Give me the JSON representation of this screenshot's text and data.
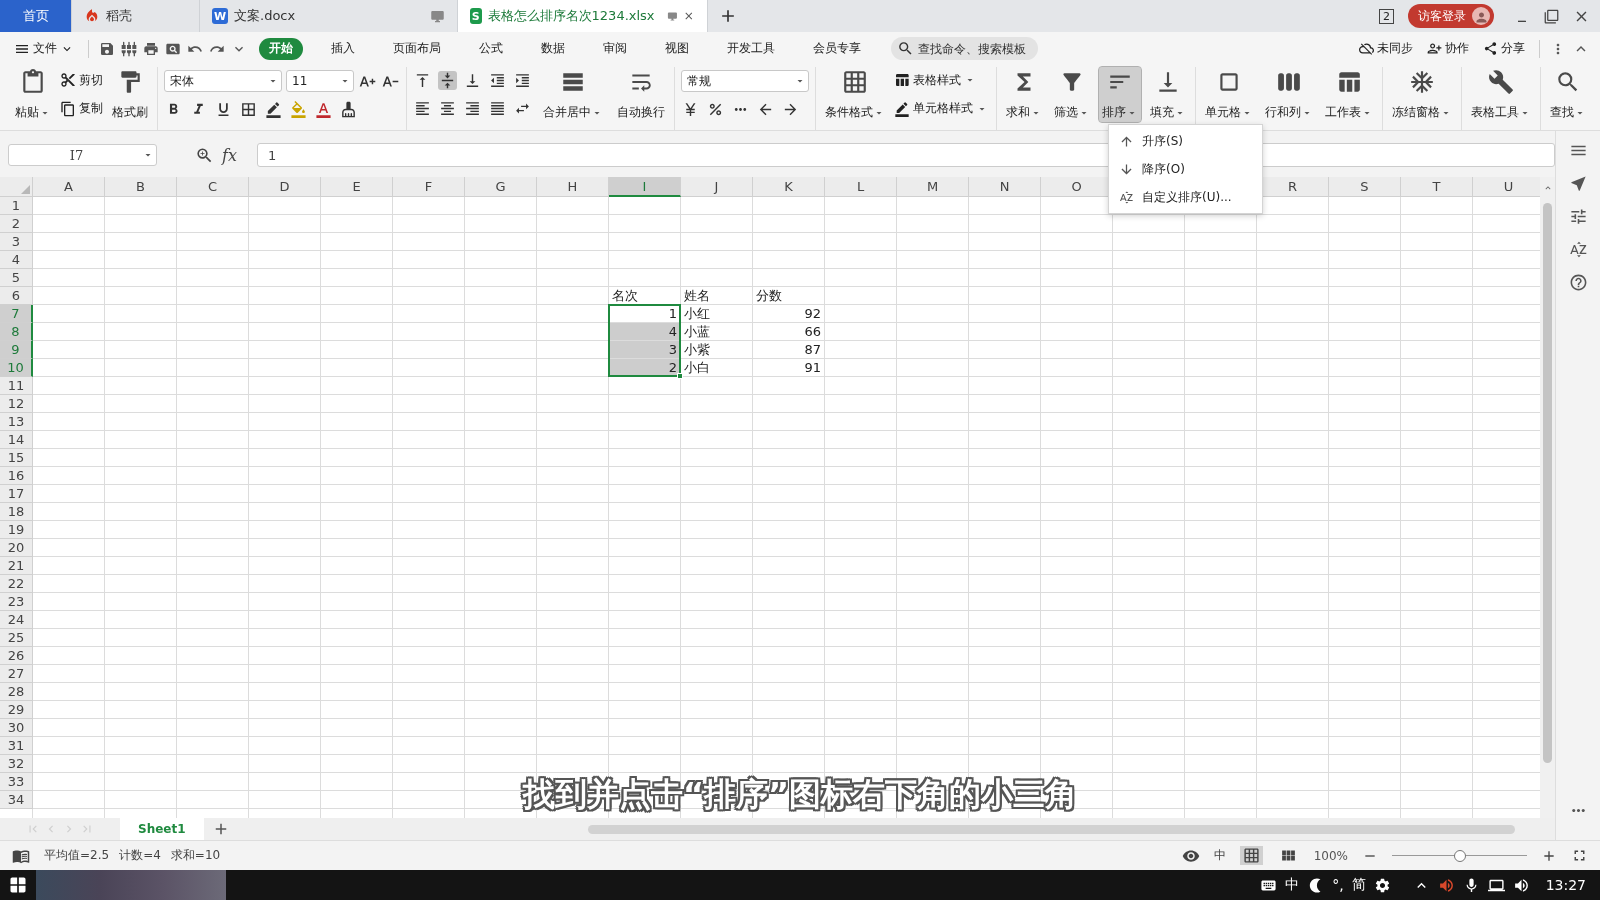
{
  "title_tabs": [
    {
      "label": "首页",
      "kind": "home",
      "selected": false
    },
    {
      "label": "稻壳",
      "kind": "docer",
      "selected": false
    },
    {
      "label": "文案.docx",
      "kind": "doc",
      "badge": "W",
      "selected": false
    },
    {
      "label": "表格怎么排序名次1234.xlsx",
      "kind": "sheet",
      "badge": "S",
      "selected": true
    }
  ],
  "window_count": "2",
  "login_button": "访客登录",
  "menu": {
    "file": "文件",
    "tabs": [
      {
        "label": "开始",
        "selected": true
      },
      {
        "label": "插入",
        "selected": false
      },
      {
        "label": "页面布局",
        "selected": false
      },
      {
        "label": "公式",
        "selected": false
      },
      {
        "label": "数据",
        "selected": false
      },
      {
        "label": "审阅",
        "selected": false
      },
      {
        "label": "视图",
        "selected": false
      },
      {
        "label": "开发工具",
        "selected": false
      },
      {
        "label": "会员专享",
        "selected": false
      }
    ],
    "search": {
      "placeholder": "查找命令、搜索模板"
    },
    "actions": [
      "未同步",
      "协作",
      "分享"
    ]
  },
  "ribbon": {
    "clipboard": {
      "paste": "粘贴",
      "cut": "剪切",
      "copy": "复制",
      "format_painter": "格式刷"
    },
    "font": {
      "name": "宋体",
      "size": "11"
    },
    "alignment": {
      "middle_pressed": true,
      "merge": "合并居中",
      "wrap": "自动换行"
    },
    "number": {
      "format": "常规"
    },
    "styles": {
      "conditional": "条件格式",
      "table_style": "表格样式",
      "cell_style": "单元格样式"
    },
    "command_groups": [
      [
        {
          "label": "求和",
          "pressed": false
        },
        {
          "label": "筛选",
          "pressed": false
        },
        {
          "label": "排序",
          "pressed": true
        },
        {
          "label": "填充",
          "pressed": false
        }
      ],
      [
        {
          "label": "单元格",
          "pressed": false
        },
        {
          "label": "行和列",
          "pressed": false
        },
        {
          "label": "工作表",
          "pressed": false
        }
      ],
      [
        {
          "label": "冻结窗格",
          "pressed": false
        }
      ],
      [
        {
          "label": "表格工具",
          "pressed": false
        }
      ],
      [
        {
          "label": "查找",
          "pressed": false
        }
      ]
    ]
  },
  "sort_menu": [
    {
      "label": "升序(S)"
    },
    {
      "label": "降序(O)"
    },
    {
      "label": "自定义排序(U)..."
    }
  ],
  "formula_bar": {
    "name_box": "I7",
    "fx": "fx",
    "value": "1"
  },
  "sheet": {
    "columns": [
      {
        "label": "A",
        "selected": false
      },
      {
        "label": "B",
        "selected": false
      },
      {
        "label": "C",
        "selected": false
      },
      {
        "label": "D",
        "selected": false
      },
      {
        "label": "E",
        "selected": false
      },
      {
        "label": "F",
        "selected": false
      },
      {
        "label": "G",
        "selected": false
      },
      {
        "label": "H",
        "selected": false
      },
      {
        "label": "I",
        "selected": true
      },
      {
        "label": "J",
        "selected": false
      },
      {
        "label": "K",
        "selected": false
      },
      {
        "label": "L",
        "selected": false
      },
      {
        "label": "M",
        "selected": false
      },
      {
        "label": "N",
        "selected": false
      },
      {
        "label": "O",
        "selected": false
      },
      null,
      null,
      {
        "label": "R",
        "selected": false
      },
      {
        "label": "S",
        "selected": false
      },
      {
        "label": "T",
        "selected": false
      },
      {
        "label": "U",
        "selected": false
      }
    ],
    "rows": [
      {
        "label": "1",
        "selected": false
      },
      {
        "label": "2",
        "selected": false
      },
      {
        "label": "3",
        "selected": false
      },
      {
        "label": "4",
        "selected": false
      },
      {
        "label": "5",
        "selected": false
      },
      {
        "label": "6",
        "selected": false
      },
      {
        "label": "7",
        "selected": true
      },
      {
        "label": "8",
        "selected": true
      },
      {
        "label": "9",
        "selected": true
      },
      {
        "label": "10",
        "selected": true
      },
      {
        "label": "11",
        "selected": false
      },
      {
        "label": "12",
        "selected": false
      },
      {
        "label": "13",
        "selected": false
      },
      {
        "label": "14",
        "selected": false
      },
      {
        "label": "15",
        "selected": false
      },
      {
        "label": "16",
        "selected": false
      },
      {
        "label": "17",
        "selected": false
      },
      {
        "label": "18",
        "selected": false
      },
      {
        "label": "19",
        "selected": false
      },
      {
        "label": "20",
        "selected": false
      },
      {
        "label": "21",
        "selected": false
      },
      {
        "label": "22",
        "selected": false
      },
      {
        "label": "23",
        "selected": false
      },
      {
        "label": "24",
        "selected": false
      },
      {
        "label": "25",
        "selected": false
      },
      {
        "label": "26",
        "selected": false
      },
      {
        "label": "27",
        "selected": false
      },
      {
        "label": "28",
        "selected": false
      },
      {
        "label": "29",
        "selected": false
      },
      {
        "label": "30",
        "selected": false
      },
      {
        "label": "31",
        "selected": false
      },
      {
        "label": "32",
        "selected": false
      },
      {
        "label": "33",
        "selected": false
      },
      {
        "label": "34",
        "selected": false
      }
    ],
    "data": [
      [
        {
          "text": "名次",
          "kind": "text",
          "selected": false
        },
        {
          "text": "姓名",
          "kind": "text",
          "selected": false
        },
        {
          "text": "分数",
          "kind": "text",
          "selected": false
        }
      ],
      [
        {
          "text": "1",
          "kind": "number",
          "selected": true,
          "active": true
        },
        {
          "text": "小红",
          "kind": "text",
          "selected": false
        },
        {
          "text": "92",
          "kind": "number",
          "selected": false
        }
      ],
      [
        {
          "text": "4",
          "kind": "number",
          "selected": true,
          "active": false
        },
        {
          "text": "小蓝",
          "kind": "text",
          "selected": false
        },
        {
          "text": "66",
          "kind": "number",
          "selected": false
        }
      ],
      [
        {
          "text": "3",
          "kind": "number",
          "selected": true,
          "active": false
        },
        {
          "text": "小紫",
          "kind": "text",
          "selected": false
        },
        {
          "text": "87",
          "kind": "number",
          "selected": false
        }
      ],
      [
        {
          "text": "2",
          "kind": "number",
          "selected": true,
          "active": false
        },
        {
          "text": "小白",
          "kind": "text",
          "selected": false
        },
        {
          "text": "91",
          "kind": "number",
          "selected": false
        }
      ]
    ]
  },
  "sheet_tabs": [
    {
      "label": "Sheet1",
      "selected": true
    }
  ],
  "status": {
    "summary": [
      "平均值=2.5",
      "计数=4",
      "求和=10"
    ],
    "input_mode": "中",
    "zoom": "100%",
    "zoom_slider": {
      "level": 0.5
    }
  },
  "taskbar": {
    "ime": [
      "中",
      "°,",
      "简"
    ],
    "time": "13:27"
  },
  "caption": "找到并点击“排序”图标右下角的小三角"
}
